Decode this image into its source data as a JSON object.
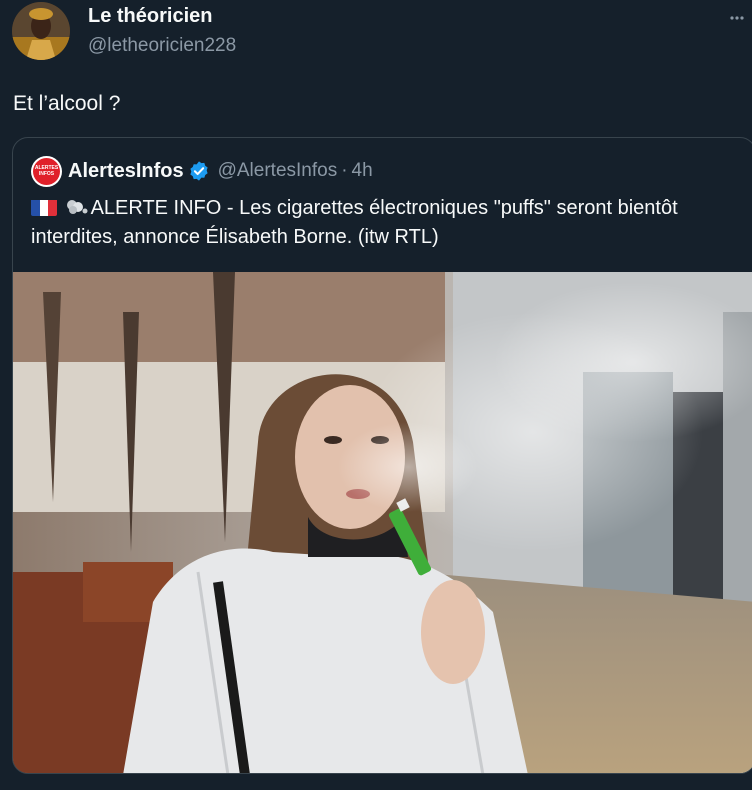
{
  "tweet": {
    "author_name": "Le théoricien",
    "author_handle": "@letheoricien228",
    "text": "Et l’alcool ?",
    "more_icon": "more-dots-icon"
  },
  "quote": {
    "avatar_text_line1": "ALERTES",
    "avatar_text_line2": "INFOS",
    "author_name": "AlertesInfos",
    "verified_icon": "verified-badge-icon",
    "author_handle": "@AlertesInfos",
    "separator": "·",
    "time": "4h",
    "text": "ALERTE INFO - Les cigarettes électroniques \"puffs\" seront bientôt interdites, annonce Élisabeth Borne. (itw RTL)",
    "flag_icon": "france-flag-icon",
    "puff_icon": "dash-smoke-icon",
    "colors": {
      "verified": "#1d9bf0",
      "avatar_red": "#e0202a"
    }
  },
  "colors": {
    "background": "#15202b",
    "text": "#f7f9f9",
    "muted": "#8b98a5",
    "border": "#38444d"
  }
}
